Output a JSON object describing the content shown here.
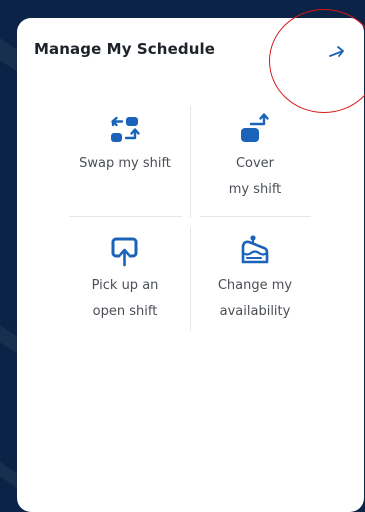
{
  "card": {
    "title": "Manage My Schedule",
    "open_icon": "arrow-right-icon"
  },
  "actions": [
    {
      "label": "Swap my shift",
      "icon": "swap-shift-icon"
    },
    {
      "label": "Cover my shift",
      "icon": "cover-shift-icon"
    },
    {
      "label": "Pick up an open shift",
      "icon": "pickup-shift-icon"
    },
    {
      "label": "Change my availability",
      "icon": "availability-icon"
    }
  ],
  "colors": {
    "accent": "#1a63b8",
    "background": "#0b2346",
    "highlight": "#d91a1a"
  }
}
